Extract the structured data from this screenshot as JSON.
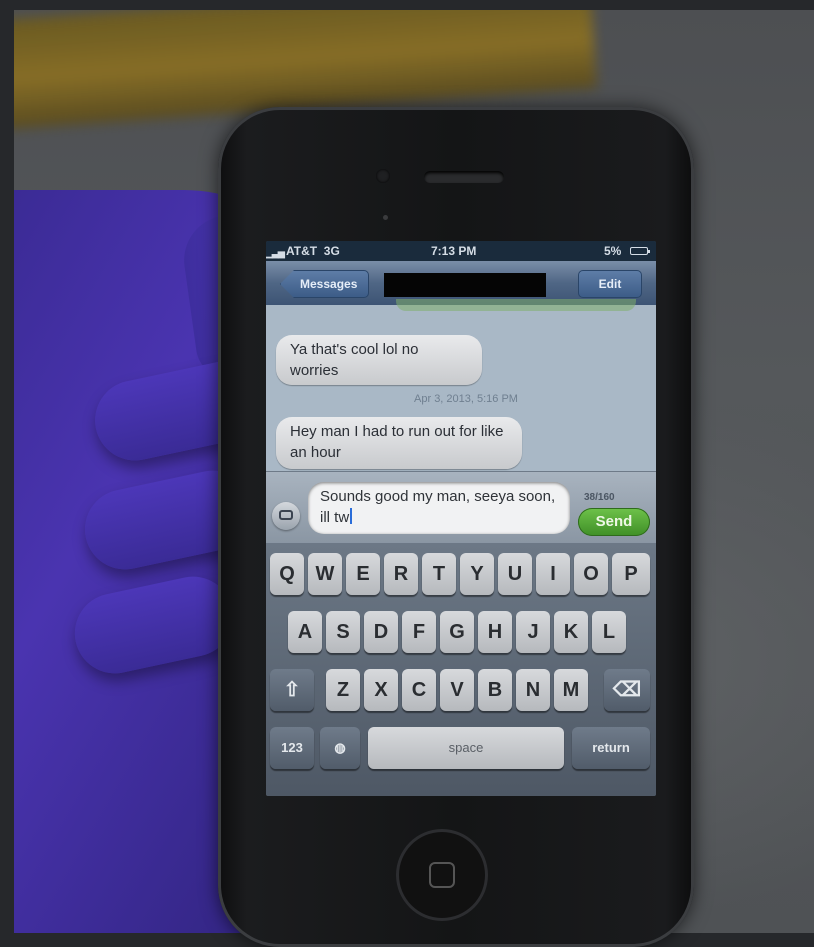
{
  "status_bar": {
    "carrier": "AT&T",
    "network": "3G",
    "time": "7:13 PM",
    "battery": "5%"
  },
  "nav": {
    "back_label": "Messages",
    "edit_label": "Edit"
  },
  "messages": [
    {
      "text": "Ya that's cool lol no worries"
    },
    {
      "text": "Hey man I had to run out for like an hour"
    }
  ],
  "timestamp": "Apr 3, 2013, 5:16 PM",
  "compose": {
    "value": "Sounds good my man, seeya soon, ill tw",
    "char_count": "38/160",
    "send_label": "Send"
  },
  "keyboard": {
    "row1": [
      "Q",
      "W",
      "E",
      "R",
      "T",
      "Y",
      "U",
      "I",
      "O",
      "P"
    ],
    "row2": [
      "A",
      "S",
      "D",
      "F",
      "G",
      "H",
      "J",
      "K",
      "L"
    ],
    "row3": [
      "Z",
      "X",
      "C",
      "V",
      "B",
      "N",
      "M"
    ],
    "numbers_label": "123",
    "space_label": "space",
    "return_label": "return"
  },
  "icons": {
    "shift": "shift-icon",
    "delete": "delete-icon",
    "globe": "globe-icon",
    "camera": "camera-icon"
  }
}
